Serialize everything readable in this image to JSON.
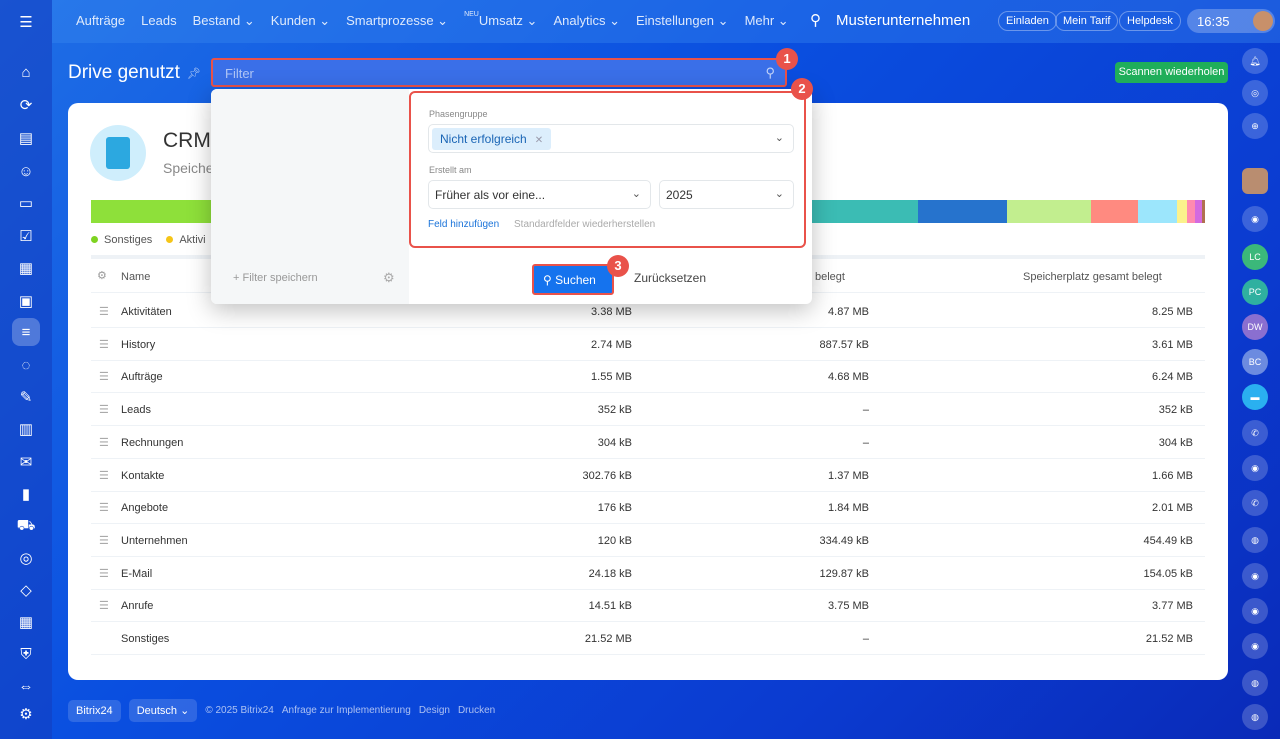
{
  "topbar": {
    "nav": [
      "Aufträge",
      "Leads",
      "Bestand",
      "Kunden",
      "Smartprozesse",
      "Umsatz",
      "Analytics",
      "Einstellungen",
      "Mehr"
    ],
    "new_badge": "NEU",
    "company": "Musterunternehmen",
    "invite": "Einladen",
    "tariff": "Mein Tarif",
    "helpdesk": "Helpdesk",
    "time": "16:35"
  },
  "right_sidebar": {
    "avatars": [
      "LC",
      "PC",
      "DW",
      "BC"
    ]
  },
  "page": {
    "title": "Drive genutzt",
    "filter_placeholder": "Filter",
    "scan_button": "Scannen wiederholen"
  },
  "card": {
    "title": "CRM-",
    "subtitle": "Speiche",
    "legend": [
      {
        "label": "Sonstiges",
        "color": "#7ed321"
      },
      {
        "label": "Aktivi",
        "color": "#f5c518"
      }
    ]
  },
  "usage_bar": {
    "colors": [
      "#8ee03a",
      "#3bbcb4",
      "#2673cd",
      "#c2ee8f",
      "#ff8a80",
      "#9ce6fc",
      "#fbf28c",
      "#ff8ab0",
      "#d36ae0",
      "#b07050"
    ],
    "shares": [
      64,
      10,
      8,
      7.5,
      4.2,
      3.5,
      0.9,
      0.7,
      0.6,
      0.3
    ]
  },
  "table": {
    "headers": [
      "Name",
      "belegt",
      "Speicherplatz gesamt belegt"
    ],
    "rows": [
      [
        "Aktivitäten",
        "3.38 MB",
        "4.87 MB",
        "8.25 MB"
      ],
      [
        "History",
        "2.74 MB",
        "887.57 kB",
        "3.61 MB"
      ],
      [
        "Aufträge",
        "1.55 MB",
        "4.68 MB",
        "6.24 MB"
      ],
      [
        "Leads",
        "352 kB",
        "–",
        "352 kB"
      ],
      [
        "Rechnungen",
        "304 kB",
        "–",
        "304 kB"
      ],
      [
        "Kontakte",
        "302.76 kB",
        "1.37 MB",
        "1.66 MB"
      ],
      [
        "Angebote",
        "176 kB",
        "1.84 MB",
        "2.01 MB"
      ],
      [
        "Unternehmen",
        "120 kB",
        "334.49 kB",
        "454.49 kB"
      ],
      [
        "E-Mail",
        "24.18 kB",
        "129.87 kB",
        "154.05 kB"
      ],
      [
        "Anrufe",
        "14.51 kB",
        "3.75 MB",
        "3.77 MB"
      ],
      [
        "Sonstiges",
        "21.52 MB",
        "–",
        "21.52 MB"
      ]
    ]
  },
  "filter_popup": {
    "save_filter": "+ Filter speichern",
    "phase_label": "Phasengruppe",
    "phase_tag": "Nicht erfolgreich",
    "created_label": "Erstellt am",
    "created_op": "Früher als vor eine...",
    "created_year": "2025",
    "add_field": "Feld hinzufügen",
    "restore": "Standardfelder wiederherstellen",
    "search": "Suchen",
    "reset": "Zurücksetzen"
  },
  "badges": [
    "1",
    "2",
    "3"
  ],
  "footer": {
    "brand": "Bitrix24",
    "language": "Deutsch",
    "copyright": "© 2025 Bitrix24",
    "links": [
      "Anfrage zur Implementierung",
      "Design",
      "Drucken"
    ]
  }
}
